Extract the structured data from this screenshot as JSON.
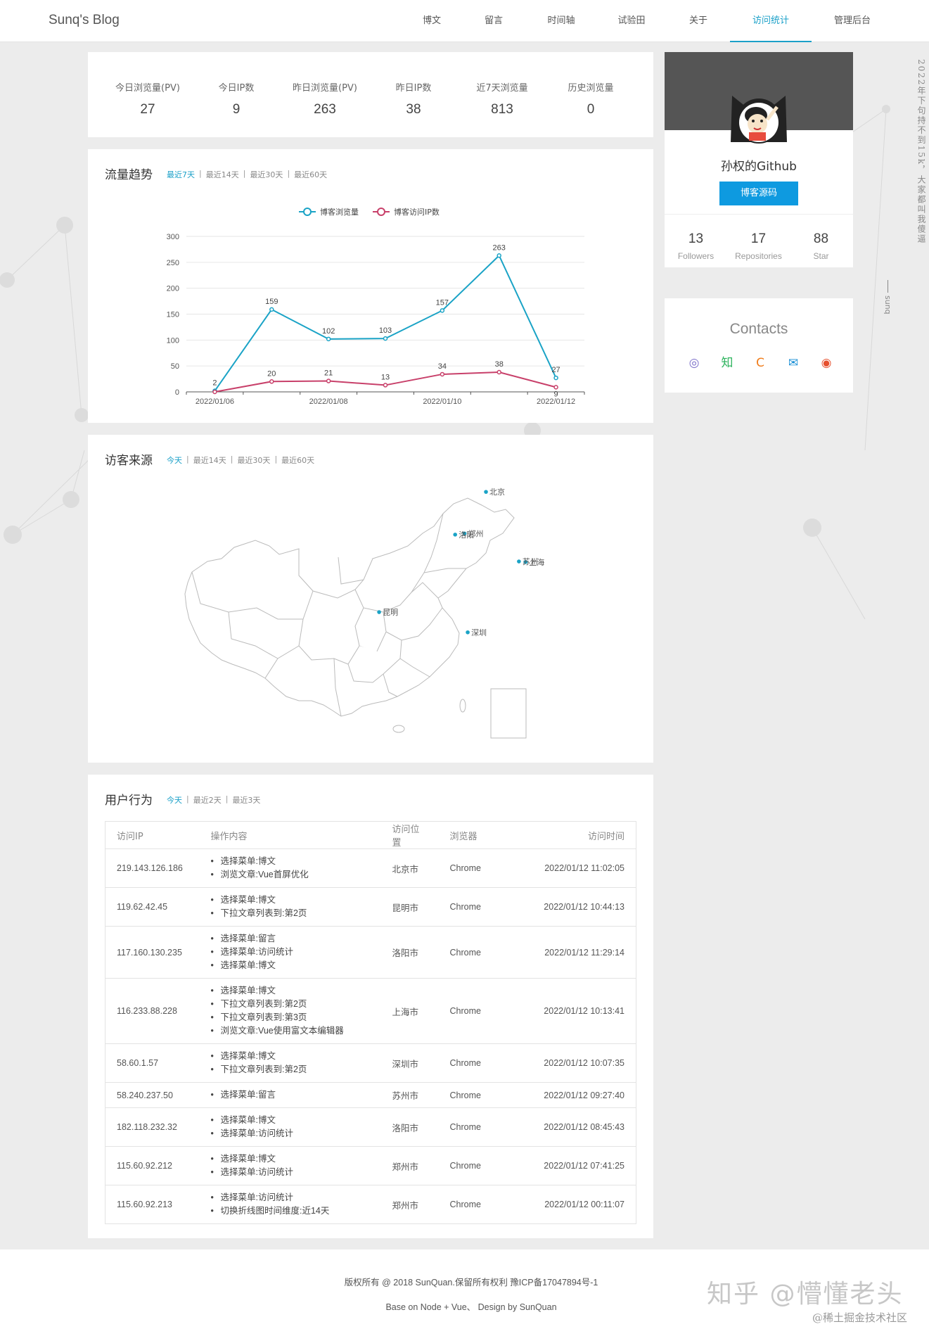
{
  "nav": {
    "brand": "Sunq's Blog",
    "items": [
      "博文",
      "留言",
      "时间轴",
      "试验田",
      "关于",
      "访问统计",
      "管理后台"
    ],
    "active": "访问统计"
  },
  "stats": [
    {
      "label": "今日浏览量(PV)",
      "value": "27"
    },
    {
      "label": "今日IP数",
      "value": "9"
    },
    {
      "label": "昨日浏览量(PV)",
      "value": "263"
    },
    {
      "label": "昨日IP数",
      "value": "38"
    },
    {
      "label": "近7天浏览量",
      "value": "813"
    },
    {
      "label": "历史浏览量",
      "value": "0"
    }
  ],
  "trend": {
    "title": "流量趋势",
    "tabs": [
      "最近7天",
      "最近14天",
      "最近30天",
      "最近60天"
    ],
    "active_tab": "最近7天"
  },
  "chart_data": {
    "type": "line",
    "x": [
      "2022/01/06",
      "2022/01/07",
      "2022/01/08",
      "2022/01/09",
      "2022/01/10",
      "2022/01/11",
      "2022/01/12"
    ],
    "x_tick_labels": [
      "2022/01/06",
      "2022/01/08",
      "2022/01/10",
      "2022/01/12"
    ],
    "series": [
      {
        "name": "博客浏览量",
        "values": [
          2,
          159,
          102,
          103,
          157,
          263,
          27
        ],
        "color": "#1aa3c6"
      },
      {
        "name": "博客访问IP数",
        "values": [
          0,
          20,
          21,
          13,
          34,
          38,
          9
        ],
        "color": "#c8406a"
      }
    ],
    "ylim": [
      0,
      300
    ],
    "yticks": [
      0,
      50,
      100,
      150,
      200,
      250,
      300
    ],
    "grid": true,
    "legend": "top-center",
    "title": "",
    "xlabel": "",
    "ylabel": ""
  },
  "visitors": {
    "title": "访客来源",
    "tabs": [
      "今天",
      "最近14天",
      "最近30天",
      "最近60天"
    ],
    "active_tab": "今天",
    "cities": [
      {
        "name": "北京",
        "lon": 116.4,
        "lat": 39.9
      },
      {
        "name": "郑州",
        "lon": 113.65,
        "lat": 34.76
      },
      {
        "name": "洛阳",
        "lon": 112.45,
        "lat": 34.62
      },
      {
        "name": "上海",
        "lon": 121.47,
        "lat": 31.23
      },
      {
        "name": "苏州",
        "lon": 120.62,
        "lat": 31.3
      },
      {
        "name": "昆明",
        "lon": 102.71,
        "lat": 25.04
      },
      {
        "name": "深圳",
        "lon": 114.06,
        "lat": 22.54
      }
    ],
    "city_color": "#1aa3c6"
  },
  "behavior": {
    "title": "用户行为",
    "tabs": [
      "今天",
      "最近2天",
      "最近3天"
    ],
    "active_tab": "今天",
    "columns": [
      "访问IP",
      "操作内容",
      "访问位置",
      "浏览器",
      "访问时间"
    ],
    "rows": [
      {
        "ip": "219.143.126.186",
        "ops": [
          "选择菜单:博文",
          "浏览文章:Vue首屏优化"
        ],
        "loc": "北京市",
        "browser": "Chrome",
        "time": "2022/01/12 11:02:05"
      },
      {
        "ip": "119.62.42.45",
        "ops": [
          "选择菜单:博文",
          "下拉文章列表到:第2页"
        ],
        "loc": "昆明市",
        "browser": "Chrome",
        "time": "2022/01/12 10:44:13"
      },
      {
        "ip": "117.160.130.235",
        "ops": [
          "选择菜单:留言",
          "选择菜单:访问统计",
          "选择菜单:博文"
        ],
        "loc": "洛阳市",
        "browser": "Chrome",
        "time": "2022/01/12 11:29:14"
      },
      {
        "ip": "116.233.88.228",
        "ops": [
          "选择菜单:博文",
          "下拉文章列表到:第2页",
          "下拉文章列表到:第3页",
          "浏览文章:Vue使用富文本编辑器"
        ],
        "loc": "上海市",
        "browser": "Chrome",
        "time": "2022/01/12 10:13:41"
      },
      {
        "ip": "58.60.1.57",
        "ops": [
          "选择菜单:博文",
          "下拉文章列表到:第2页"
        ],
        "loc": "深圳市",
        "browser": "Chrome",
        "time": "2022/01/12 10:07:35"
      },
      {
        "ip": "58.240.237.50",
        "ops": [
          "选择菜单:留言"
        ],
        "loc": "苏州市",
        "browser": "Chrome",
        "time": "2022/01/12 09:27:40"
      },
      {
        "ip": "182.118.232.32",
        "ops": [
          "选择菜单:博文",
          "选择菜单:访问统计"
        ],
        "loc": "洛阳市",
        "browser": "Chrome",
        "time": "2022/01/12 08:45:43"
      },
      {
        "ip": "115.60.92.212",
        "ops": [
          "选择菜单:博文",
          "选择菜单:访问统计"
        ],
        "loc": "郑州市",
        "browser": "Chrome",
        "time": "2022/01/12 07:41:25"
      },
      {
        "ip": "115.60.92.213",
        "ops": [
          "选择菜单:访问统计",
          "切换折线图时间维度:近14天"
        ],
        "loc": "郑州市",
        "browser": "Chrome",
        "time": "2022/01/12 00:11:07"
      }
    ]
  },
  "github": {
    "title": "孙权的Github",
    "button": "博客源码",
    "stats": [
      {
        "num": "13",
        "label": "Followers"
      },
      {
        "num": "17",
        "label": "Repositories"
      },
      {
        "num": "88",
        "label": "Star"
      }
    ]
  },
  "contacts": {
    "title": "Contacts",
    "icons": [
      {
        "name": "github-icon",
        "glyph": "◎",
        "color": "#7b6fc9"
      },
      {
        "name": "zhihu-icon",
        "glyph": "知",
        "color": "#2db35d"
      },
      {
        "name": "csdn-icon",
        "glyph": "C",
        "color": "#f07c1a"
      },
      {
        "name": "email-icon",
        "glyph": "✉",
        "color": "#1a8fd6"
      },
      {
        "name": "weibo-icon",
        "glyph": "◉",
        "color": "#e6502e"
      }
    ]
  },
  "side_text": "2022年下句持不到15k，大家都叫我傻逼",
  "side_sig": "sunq",
  "footer": {
    "line1": "版权所有 @ 2018 SunQuan.保留所有权利    豫ICP备17047894号-1",
    "line2": "Base on Node + Vue、 Design by SunQuan"
  },
  "watermark": "知乎 @懵懂老头",
  "watermark2": "@稀土掘金技术社区"
}
